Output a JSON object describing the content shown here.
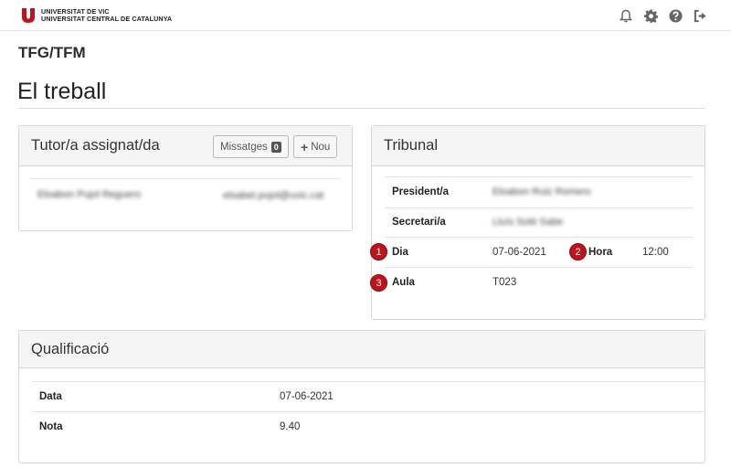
{
  "header": {
    "logo_line1": "UNIVERSITAT DE VIC",
    "logo_line2": "UNIVERSITAT CENTRAL DE CATALUNYA",
    "brand_color": "#c1121c",
    "icons": [
      "bell-icon",
      "gear-icon",
      "help-icon",
      "logout-icon"
    ]
  },
  "section": {
    "title": "TFG/TFM"
  },
  "page": {
    "title": "El treball"
  },
  "tutor": {
    "heading": "Tutor/a assignat/da",
    "messages_label": "Missatges",
    "messages_count": "0",
    "new_label": "Nou",
    "name": "Eloabon Pujol Reguero",
    "email": "elsabet.pujol@uvic.cat"
  },
  "tribunal": {
    "heading": "Tribunal",
    "president_label": "President/a",
    "president_value": "Eloabon Ruiz Romero",
    "secretari_label": "Secretari/a",
    "secretari_value": "Lluís Solé Sabe",
    "dia_label": "Dia",
    "dia_value": "07-06-2021",
    "hora_label": "Hora",
    "hora_value": "12:00",
    "aula_label": "Aula",
    "aula_value": "T023",
    "markers": [
      "1",
      "2",
      "3"
    ]
  },
  "qualificacio": {
    "heading": "Qualificació",
    "data_label": "Data",
    "data_value": "07-06-2021",
    "nota_label": "Nota",
    "nota_value": "9.40"
  }
}
